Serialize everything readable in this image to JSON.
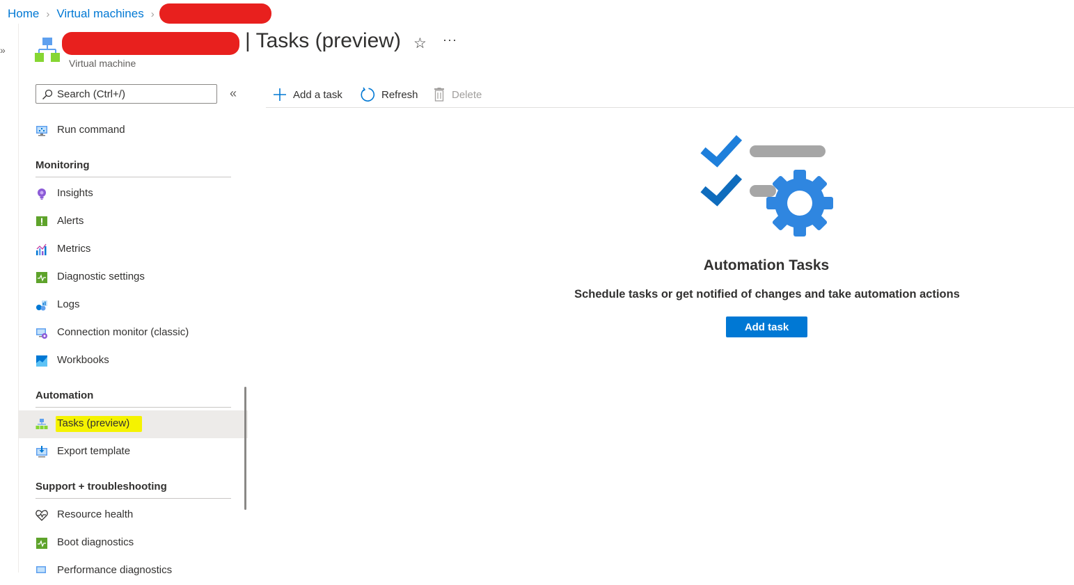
{
  "breadcrumb": {
    "home": "Home",
    "virtual_machines": "Virtual machines"
  },
  "header": {
    "title": "| Tasks (preview)",
    "subtitle": "Virtual machine",
    "favorite_icon": "star-icon",
    "more_icon": "more-icon"
  },
  "search": {
    "placeholder": "Search (Ctrl+/)",
    "value": ""
  },
  "sidebar": {
    "top_items": [
      {
        "label": "Run command",
        "icon": "run-command-icon"
      }
    ],
    "sections": [
      {
        "title": "Monitoring",
        "items": [
          {
            "label": "Insights",
            "icon": "insights-icon"
          },
          {
            "label": "Alerts",
            "icon": "alerts-icon"
          },
          {
            "label": "Metrics",
            "icon": "metrics-icon"
          },
          {
            "label": "Diagnostic settings",
            "icon": "diagnostic-settings-icon"
          },
          {
            "label": "Logs",
            "icon": "logs-icon"
          },
          {
            "label": "Connection monitor (classic)",
            "icon": "connection-monitor-icon"
          },
          {
            "label": "Workbooks",
            "icon": "workbooks-icon"
          }
        ]
      },
      {
        "title": "Automation",
        "items": [
          {
            "label": "Tasks (preview)",
            "icon": "tasks-icon",
            "selected": true
          },
          {
            "label": "Export template",
            "icon": "export-template-icon"
          }
        ]
      },
      {
        "title": "Support + troubleshooting",
        "items": [
          {
            "label": "Resource health",
            "icon": "resource-health-icon"
          },
          {
            "label": "Boot diagnostics",
            "icon": "boot-diagnostics-icon"
          },
          {
            "label": "Performance diagnostics",
            "icon": "performance-diagnostics-icon"
          }
        ]
      }
    ]
  },
  "toolbar": {
    "add": "Add a task",
    "refresh": "Refresh",
    "delete": "Delete"
  },
  "empty_state": {
    "title": "Automation Tasks",
    "description": "Schedule tasks or get notified of changes and take automation actions",
    "button": "Add task"
  },
  "colors": {
    "accent": "#0078d4",
    "highlight": "#f5f300",
    "redaction": "#e8201e"
  }
}
